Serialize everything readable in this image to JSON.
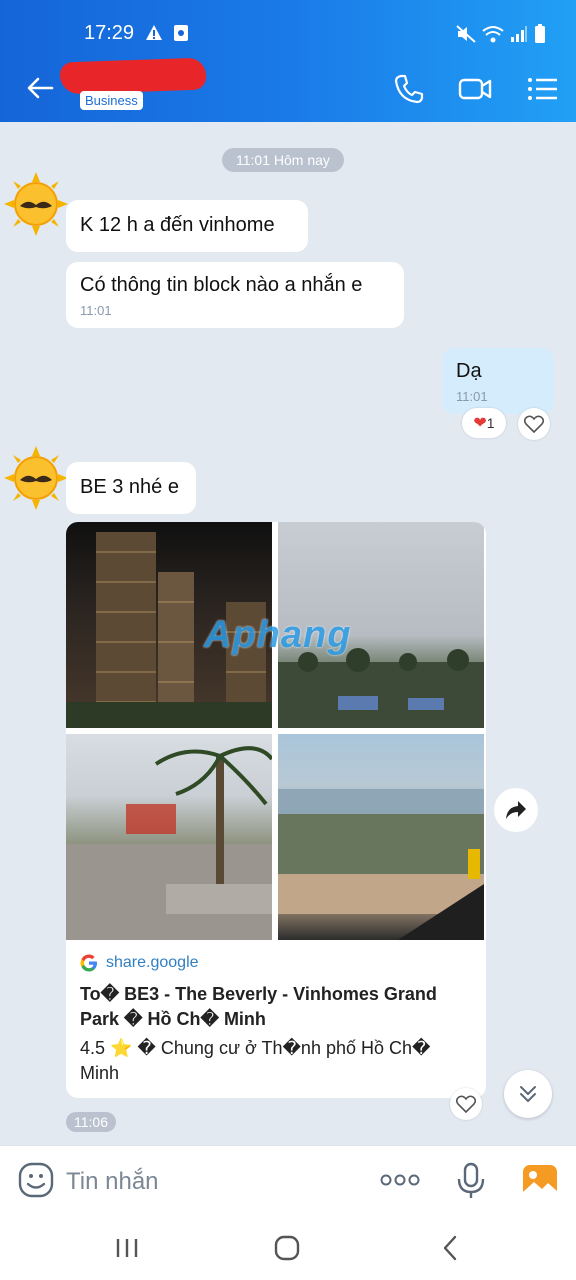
{
  "status": {
    "time": "17:29"
  },
  "header": {
    "badge": "Business"
  },
  "chat": {
    "date_pill": "11:01 Hôm nay",
    "messages": [
      {
        "text": "K 12 h a đến vinhome"
      },
      {
        "text": "Có thông tin block nào a nhắn e",
        "time": "11:01"
      },
      {
        "text": "Dạ",
        "time": "11:01",
        "reaction_count": "1"
      },
      {
        "text": "BE 3 nhé e"
      }
    ],
    "link_card": {
      "watermark": "Aphang",
      "domain": "share.google",
      "title": "To� BE3 - The Beverly - Vinhomes Grand Park � Hồ Ch� Minh",
      "description": "4.5 ⭐ � Chung cư ở Th�nh phố Hồ Ch� Minh"
    },
    "time_pill": "11:06"
  },
  "input": {
    "placeholder": "Tin nhắn"
  },
  "colors": {
    "header_start": "#1565d8",
    "header_end": "#21a0f5",
    "mine_bubble": "#d4ecfb",
    "background": "#e2e9f1"
  },
  "icons": [
    "back-arrow-icon",
    "phone-icon",
    "video-camera-icon",
    "list-menu-icon",
    "share-arrow-icon",
    "heart-icon",
    "chevron-double-down-icon",
    "emoji-icon",
    "more-dots-icon",
    "microphone-icon",
    "image-gallery-icon",
    "google-g-icon"
  ]
}
